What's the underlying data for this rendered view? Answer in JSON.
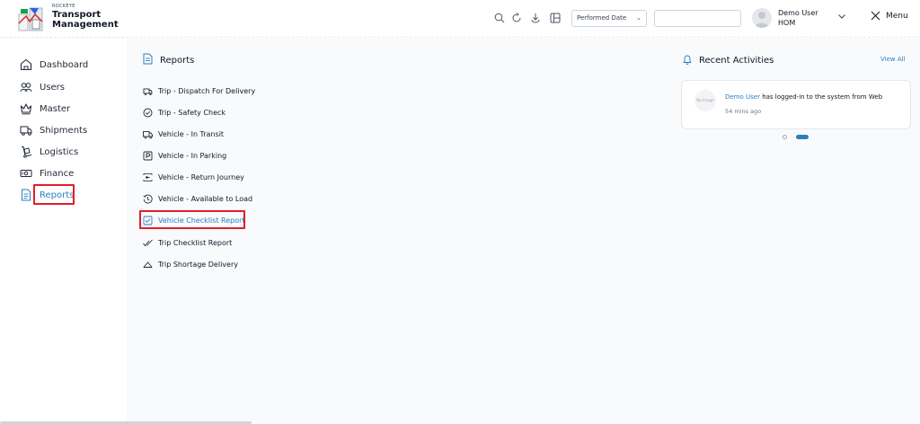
{
  "brand": {
    "small": "ROCKEYE",
    "line1": "Transport",
    "line2": "Management"
  },
  "header": {
    "icons": [
      "search-icon",
      "refresh-icon",
      "download-icon",
      "columns-icon"
    ],
    "filter_select": "Performed Date",
    "search_input": {
      "value": "",
      "placeholder": ""
    },
    "user": {
      "name": "Demo User",
      "role": "HOM"
    },
    "menu_label": "Menu"
  },
  "sidebar": {
    "items": [
      {
        "label": "Dashboard",
        "icon": "home-icon"
      },
      {
        "label": "Users",
        "icon": "users-icon"
      },
      {
        "label": "Master",
        "icon": "crown-icon"
      },
      {
        "label": "Shipments",
        "icon": "truck-icon"
      },
      {
        "label": "Logistics",
        "icon": "dolly-icon"
      },
      {
        "label": "Finance",
        "icon": "money-icon"
      },
      {
        "label": "Reports",
        "icon": "report-icon",
        "active": true
      }
    ]
  },
  "reports": {
    "title": "Reports",
    "items": [
      {
        "label": "Trip - Dispatch For Delivery",
        "icon": "dispatch-icon"
      },
      {
        "label": "Trip - Safety Check",
        "icon": "check-circle-icon"
      },
      {
        "label": "Vehicle - In Transit",
        "icon": "truck-icon"
      },
      {
        "label": "Vehicle - In Parking",
        "icon": "parking-icon"
      },
      {
        "label": "Vehicle - Return Journey",
        "icon": "return-icon"
      },
      {
        "label": "Vehicle - Available to Load",
        "icon": "history-icon"
      },
      {
        "label": "Vehicle Checklist Report",
        "icon": "checkbox-icon",
        "active": true
      },
      {
        "label": "Trip Checklist Report",
        "icon": "double-check-icon"
      },
      {
        "label": "Trip Shortage Delivery",
        "icon": "triangle-icon"
      }
    ]
  },
  "activities": {
    "title": "Recent Activities",
    "view_all": "View All",
    "items": [
      {
        "avatar_text": "No Image",
        "user": "Demo User",
        "message": " has logged-in to the system from Web",
        "time": "54 mins ago"
      }
    ]
  },
  "colors": {
    "accent": "#2b7fbd",
    "highlight": "#e11d2d"
  }
}
